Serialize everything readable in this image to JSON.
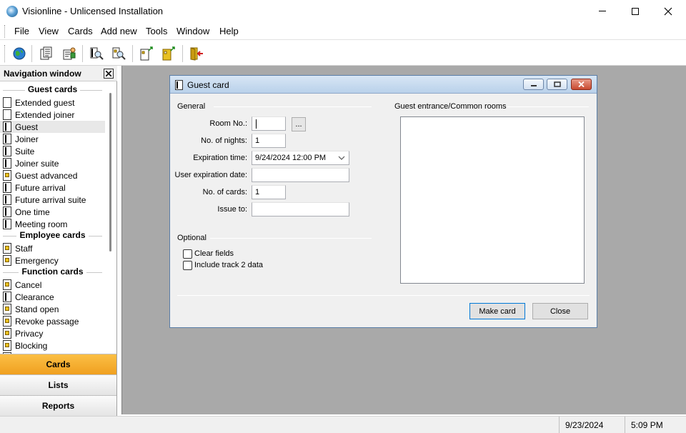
{
  "window": {
    "title": "Visionline - Unlicensed Installation"
  },
  "menu": [
    "File",
    "View",
    "Cards",
    "Add new",
    "Tools",
    "Window",
    "Help"
  ],
  "toolbar": {
    "icons": [
      "globe-icon",
      "report-icon",
      "user-report-icon",
      "search-card-icon",
      "find-card-icon",
      "new-card-icon",
      "copy-card-icon",
      "exit-icon"
    ]
  },
  "nav": {
    "title": "Navigation window",
    "groups": {
      "guest": "Guest cards",
      "employee": "Employee cards",
      "function": "Function cards"
    },
    "guest_items": [
      {
        "label": "Extended guest",
        "icon": "plain"
      },
      {
        "label": "Extended joiner",
        "icon": "plain"
      },
      {
        "label": "Guest",
        "icon": "dark"
      },
      {
        "label": "Joiner",
        "icon": "dark"
      },
      {
        "label": "Suite",
        "icon": "dark"
      },
      {
        "label": "Joiner suite",
        "icon": "dark"
      },
      {
        "label": "Guest advanced",
        "icon": "yellow"
      },
      {
        "label": "Future arrival",
        "icon": "dark"
      },
      {
        "label": "Future arrival suite",
        "icon": "dark"
      },
      {
        "label": "One time",
        "icon": "dark"
      },
      {
        "label": "Meeting room",
        "icon": "dark"
      }
    ],
    "employee_items": [
      {
        "label": "Staff",
        "icon": "yellow"
      },
      {
        "label": "Emergency",
        "icon": "yellow"
      }
    ],
    "function_items": [
      {
        "label": "Cancel",
        "icon": "yellow"
      },
      {
        "label": "Clearance",
        "icon": "dark"
      },
      {
        "label": "Stand open",
        "icon": "yellow"
      },
      {
        "label": "Revoke passage",
        "icon": "yellow"
      },
      {
        "label": "Privacy",
        "icon": "yellow"
      },
      {
        "label": "Blocking",
        "icon": "yellow"
      }
    ],
    "selected": "Guest",
    "tabs": [
      "Cards",
      "Lists",
      "Reports"
    ]
  },
  "dialog": {
    "title": "Guest card",
    "general_label": "General",
    "guest_entrance_label": "Guest entrance/Common rooms",
    "fields": {
      "room_no_label": "Room No.:",
      "room_no_value": "",
      "browse_label": "...",
      "nights_label": "No. of nights:",
      "nights_value": "1",
      "expiration_label": "Expiration time:",
      "expiration_value": "9/24/2024 12:00 PM",
      "user_expiration_label": "User expiration date:",
      "user_expiration_value": "",
      "cards_label": "No. of cards:",
      "cards_value": "1",
      "issue_to_label": "Issue to:",
      "issue_to_value": ""
    },
    "optional_label": "Optional",
    "options": {
      "clear_fields": "Clear fields",
      "track2": "Include track 2 data"
    },
    "buttons": {
      "make_card": "Make card",
      "close": "Close"
    }
  },
  "status": {
    "date": "9/23/2024",
    "time": "5:09 PM"
  }
}
